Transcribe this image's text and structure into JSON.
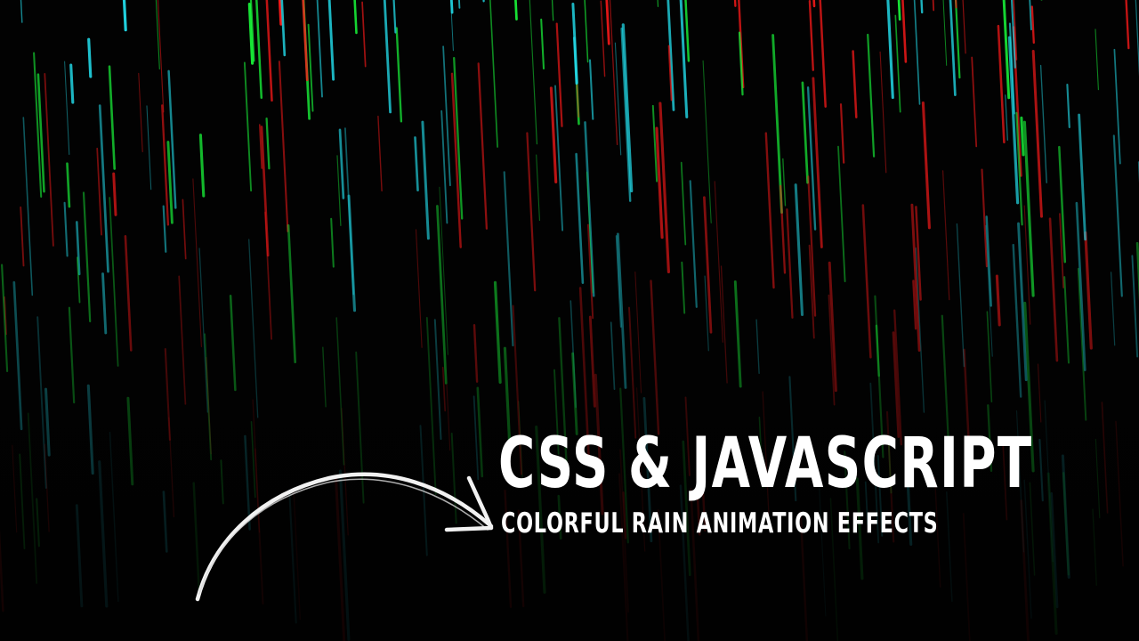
{
  "title": {
    "headline": "CSS & JAVASCRIPT",
    "subtitle": "COLORFUL RAIN ANIMATION EFFECTS"
  },
  "rain_colors": [
    "#ff1a1a",
    "#1aff3c",
    "#22d8e6"
  ],
  "background_color": "#020202",
  "decoration": {
    "arrow_icon": "hand-drawn-curved-arrow-icon"
  }
}
